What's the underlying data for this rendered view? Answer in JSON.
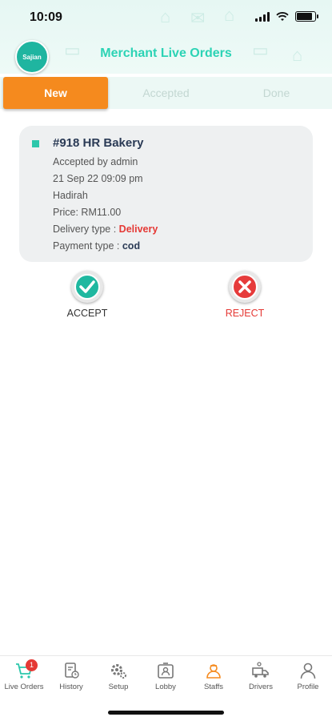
{
  "status_bar": {
    "time": "10:09"
  },
  "header": {
    "logo_text": "Sajian",
    "title": "Merchant Live Orders"
  },
  "tabs": [
    {
      "label": "New",
      "active": true
    },
    {
      "label": "Accepted",
      "active": false
    },
    {
      "label": "Done",
      "active": false
    }
  ],
  "order": {
    "title": "#918 HR Bakery",
    "accepted_by": "Accepted by admin",
    "datetime": "21 Sep 22 09:09 pm",
    "customer": "Hadirah",
    "price": "Price: RM11.00",
    "delivery_label": "Delivery type : ",
    "delivery_value": "Delivery",
    "payment_label": "Payment type : ",
    "payment_value": "cod"
  },
  "actions": {
    "accept": "ACCEPT",
    "reject": "REJECT"
  },
  "bottom_nav": [
    {
      "label": "Live Orders",
      "icon": "cart-icon",
      "badge": "1",
      "active": true
    },
    {
      "label": "History",
      "icon": "history-icon"
    },
    {
      "label": "Setup",
      "icon": "gear-icon"
    },
    {
      "label": "Lobby",
      "icon": "lobby-icon"
    },
    {
      "label": "Staffs",
      "icon": "staff-icon"
    },
    {
      "label": "Drivers",
      "icon": "truck-icon"
    },
    {
      "label": "Profile",
      "icon": "person-icon"
    }
  ],
  "colors": {
    "accent": "#2cd3b5",
    "active_tab": "#f58a1e",
    "danger": "#e53935"
  }
}
